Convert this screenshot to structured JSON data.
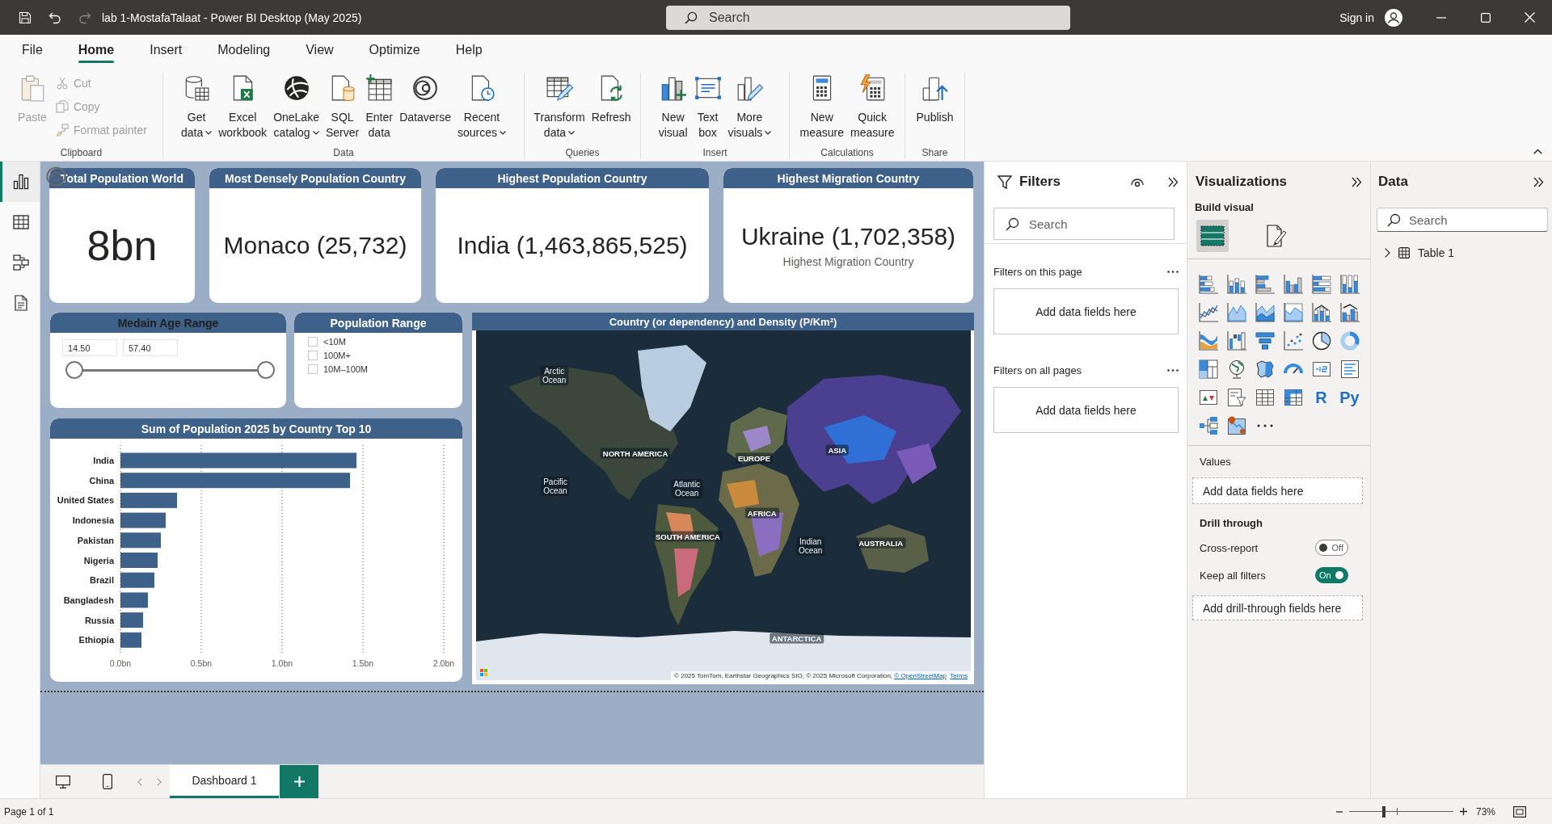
{
  "window": {
    "title": "lab 1-MostafaTalaat - Power BI Desktop (May 2025)",
    "search_placeholder": "Search",
    "sign_in": "Sign in"
  },
  "quick_access": [
    {
      "kind": "save",
      "disabled": false
    },
    {
      "kind": "undo",
      "disabled": false
    },
    {
      "kind": "redo",
      "disabled": true
    }
  ],
  "menu_tabs": [
    {
      "label": "File",
      "selected": false
    },
    {
      "label": "Home",
      "selected": true
    },
    {
      "label": "Insert",
      "selected": false
    },
    {
      "label": "Modeling",
      "selected": false
    },
    {
      "label": "View",
      "selected": false
    },
    {
      "label": "Optimize",
      "selected": false
    },
    {
      "label": "Help",
      "selected": false
    }
  ],
  "ribbon": {
    "groups": [
      {
        "label": "Clipboard",
        "buttons": [
          {
            "kind": "paste",
            "lines": [
              "Paste"
            ],
            "menu": false,
            "disabled": true
          }
        ],
        "small_buttons": [
          {
            "kind": "cut",
            "label": "Cut",
            "disabled": true
          },
          {
            "kind": "copy",
            "label": "Copy",
            "disabled": true
          },
          {
            "kind": "format-painter",
            "label": "Format painter",
            "disabled": true
          }
        ]
      },
      {
        "label": "Data",
        "buttons": [
          {
            "kind": "get-data",
            "lines": [
              "Get",
              "data"
            ],
            "menu": true,
            "disabled": false
          },
          {
            "kind": "excel",
            "lines": [
              "Excel",
              "workbook"
            ],
            "menu": false,
            "disabled": false
          },
          {
            "kind": "onelake",
            "lines": [
              "OneLake",
              "catalog"
            ],
            "menu": true,
            "disabled": false
          },
          {
            "kind": "sql",
            "lines": [
              "SQL",
              "Server"
            ],
            "menu": false,
            "disabled": false
          },
          {
            "kind": "enter-data",
            "lines": [
              "Enter",
              "data"
            ],
            "menu": false,
            "disabled": false
          },
          {
            "kind": "dataverse",
            "lines": [
              "Dataverse"
            ],
            "menu": false,
            "disabled": false
          },
          {
            "kind": "recent",
            "lines": [
              "Recent",
              "sources"
            ],
            "menu": true,
            "disabled": false
          }
        ]
      },
      {
        "label": "Queries",
        "buttons": [
          {
            "kind": "transform",
            "lines": [
              "Transform",
              "data"
            ],
            "menu": true,
            "disabled": false
          },
          {
            "kind": "refresh",
            "lines": [
              "Refresh"
            ],
            "menu": false,
            "disabled": false
          }
        ]
      },
      {
        "label": "Insert",
        "buttons": [
          {
            "kind": "new-visual",
            "lines": [
              "New",
              "visual"
            ],
            "menu": false,
            "disabled": false
          },
          {
            "kind": "text-box",
            "lines": [
              "Text",
              "box"
            ],
            "menu": false,
            "disabled": false
          },
          {
            "kind": "more-visuals",
            "lines": [
              "More",
              "visuals"
            ],
            "menu": true,
            "disabled": false
          }
        ]
      },
      {
        "label": "Calculations",
        "buttons": [
          {
            "kind": "new-measure",
            "lines": [
              "New",
              "measure"
            ],
            "menu": false,
            "disabled": false
          },
          {
            "kind": "quick-measure",
            "lines": [
              "Quick",
              "measure"
            ],
            "menu": false,
            "disabled": false
          }
        ]
      },
      {
        "label": "Share",
        "buttons": [
          {
            "kind": "publish",
            "lines": [
              "Publish"
            ],
            "menu": false,
            "disabled": false
          }
        ]
      }
    ]
  },
  "views": [
    {
      "kind": "report",
      "selected": true
    },
    {
      "kind": "table",
      "selected": false
    },
    {
      "kind": "model",
      "selected": false
    },
    {
      "kind": "dax",
      "selected": false
    }
  ],
  "report": {
    "cards": [
      {
        "title": "Total Population World",
        "value": "8bn"
      },
      {
        "title": "Most Densely Population Country",
        "value": "Monaco (25,732)"
      },
      {
        "title": "Highest Population Country",
        "value": "India (1,463,865,525)"
      },
      {
        "title": "Highest Migration Country",
        "value": "Ukraine (1,702,358)",
        "caption": "Highest Migration Country"
      }
    ],
    "age_slicer": {
      "title": "Medain Age Range",
      "min_value": "14.50",
      "max_value": "57.40",
      "handles": [
        {
          "level": 0
        },
        {
          "level": 1
        }
      ]
    },
    "population_slicer": {
      "title": "Population Range",
      "options": [
        {
          "label": "<10M",
          "checked": false
        },
        {
          "label": "100M+",
          "checked": false
        },
        {
          "label": "10M–100M",
          "checked": false
        }
      ]
    },
    "bar_chart": {
      "chart_data": {
        "type": "bar",
        "orientation": "horizontal",
        "title": "Sum of Population 2025 by Country Top 10",
        "categories": [
          "India",
          "China",
          "United States",
          "Indonesia",
          "Pakistan",
          "Nigeria",
          "Brazil",
          "Bangladesh",
          "Russia",
          "Ethiopia"
        ],
        "values": [
          1.46,
          1.42,
          0.35,
          0.28,
          0.25,
          0.23,
          0.21,
          0.17,
          0.14,
          0.13
        ],
        "color": "#3d6189",
        "xlim": [
          0,
          2
        ],
        "xticks": [
          {
            "value": 0,
            "label": "0.0bn"
          },
          {
            "value": 0.5,
            "label": "0.5bn"
          },
          {
            "value": 1,
            "label": "1.0bn"
          },
          {
            "value": 1.5,
            "label": "1.5bn"
          },
          {
            "value": 2,
            "label": "2.0bn"
          }
        ],
        "grid": true
      }
    },
    "map": {
      "title": "Country (or dependency) and Density (P/Km²)",
      "labels": [
        {
          "text": "Arctic Ocean",
          "kind": "ocean"
        },
        {
          "text": "NORTH AMERICA",
          "kind": "continent"
        },
        {
          "text": "EUROPE",
          "kind": "continent"
        },
        {
          "text": "ASIA",
          "kind": "continent"
        },
        {
          "text": "Pacific Ocean",
          "kind": "ocean"
        },
        {
          "text": "Atlantic Ocean",
          "kind": "ocean"
        },
        {
          "text": "AFRICA",
          "kind": "continent"
        },
        {
          "text": "SOUTH AMERICA",
          "kind": "continent"
        },
        {
          "text": "Indian Ocean",
          "kind": "ocean"
        },
        {
          "text": "AUSTRALIA",
          "kind": "continent"
        },
        {
          "text": "ANTARCTICA",
          "kind": "continent"
        }
      ],
      "attribution": "© 2025 TomTom, Earthstar Geographics SIO, © 2025 Microsoft Corporation,",
      "links": [
        "© OpenStreetMap",
        "Terms"
      ]
    }
  },
  "filters_pane": {
    "title": "Filters",
    "search_placeholder": "Search",
    "sections": [
      {
        "label": "Filters on this page",
        "drop_hint": "Add data fields here"
      },
      {
        "label": "Filters on all pages",
        "drop_hint": "Add data fields here"
      }
    ]
  },
  "visualizations_pane": {
    "title": "Visualizations",
    "subtitle": "Build visual",
    "modes": [
      {
        "kind": "build",
        "selected": true
      },
      {
        "kind": "format",
        "selected": false
      }
    ],
    "gallery": [
      {
        "kind": "stacked-bar"
      },
      {
        "kind": "stacked-column"
      },
      {
        "kind": "clustered-bar"
      },
      {
        "kind": "clustered-column"
      },
      {
        "kind": "percent-bar"
      },
      {
        "kind": "percent-column"
      },
      {
        "kind": "line"
      },
      {
        "kind": "area"
      },
      {
        "kind": "stacked-area"
      },
      {
        "kind": "percent-area"
      },
      {
        "kind": "line-stacked-column"
      },
      {
        "kind": "line-clustered-column"
      },
      {
        "kind": "ribbon"
      },
      {
        "kind": "waterfall"
      },
      {
        "kind": "funnel"
      },
      {
        "kind": "scatter"
      },
      {
        "kind": "pie"
      },
      {
        "kind": "donut"
      },
      {
        "kind": "treemap"
      },
      {
        "kind": "map"
      },
      {
        "kind": "filled-map"
      },
      {
        "kind": "gauge"
      },
      {
        "kind": "card"
      },
      {
        "kind": "multi-row-card"
      },
      {
        "kind": "kpi"
      },
      {
        "kind": "slicer"
      },
      {
        "kind": "table"
      },
      {
        "kind": "matrix"
      },
      {
        "kind": "r-visual",
        "glyph": "R"
      },
      {
        "kind": "python-visual",
        "glyph": "Py"
      },
      {
        "kind": "decomposition-tree"
      },
      {
        "kind": "azure-map"
      },
      {
        "kind": "more"
      }
    ],
    "values_label": "Values",
    "values_hint": "Add data fields here",
    "drill_label": "Drill through",
    "toggles": [
      {
        "label": "Cross-report",
        "on": false,
        "state_text": "Off"
      },
      {
        "label": "Keep all filters",
        "on": true,
        "state_text": "On"
      }
    ],
    "drill_hint": "Add drill-through fields here"
  },
  "data_pane": {
    "title": "Data",
    "search_placeholder": "Search",
    "tables": [
      {
        "name": "Table 1",
        "expanded": false
      }
    ]
  },
  "page_tabs": [
    {
      "label": "Dashboard 1",
      "selected": true
    }
  ],
  "status_bar": {
    "page_info": "Page 1 of 1",
    "zoom": {
      "level": 0.33,
      "reading": "73%"
    }
  }
}
